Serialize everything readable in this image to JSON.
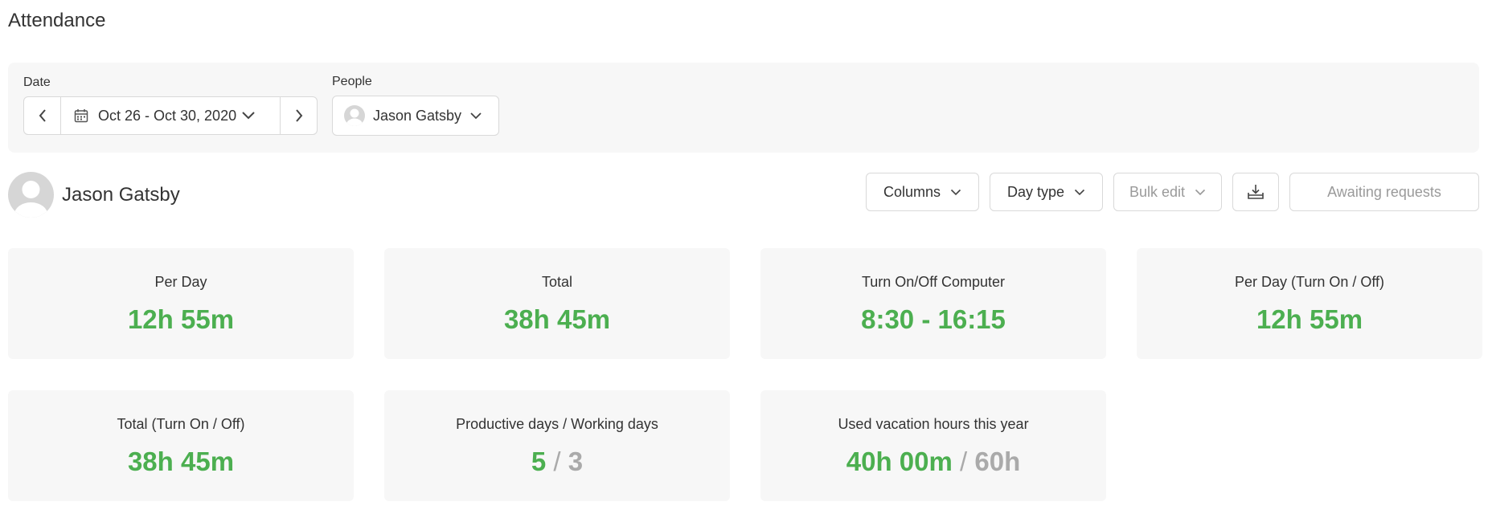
{
  "page": {
    "title": "Attendance"
  },
  "filters": {
    "date_label": "Date",
    "date_range": "Oct 26 - Oct 30, 2020",
    "people_label": "People",
    "people_value": "Jason Gatsby"
  },
  "user": {
    "name": "Jason Gatsby"
  },
  "toolbar": {
    "columns_label": "Columns",
    "day_type_label": "Day type",
    "bulk_edit_label": "Bulk edit",
    "awaiting_label": "Awaiting requests"
  },
  "stats": {
    "per_day": {
      "label": "Per Day",
      "value": "12h 55m"
    },
    "total": {
      "label": "Total",
      "value": "38h 45m"
    },
    "turn_on_off": {
      "label": "Turn On/Off Computer",
      "value": "8:30 - 16:15"
    },
    "per_day_turn": {
      "label": "Per Day (Turn On / Off)",
      "value": "12h 55m"
    },
    "total_turn": {
      "label": "Total (Turn On / Off)",
      "value": "38h 45m"
    },
    "productive": {
      "label": "Productive days / Working days",
      "value": "5",
      "separator": "/",
      "secondary": "3"
    },
    "vacation": {
      "label": "Used vacation hours this year",
      "value": "40h 00m",
      "separator": "/",
      "secondary": "60h"
    }
  },
  "colors": {
    "accent_green": "#4caf50",
    "muted_gray": "#aaaaaa",
    "panel_bg": "#f7f7f7",
    "border": "#d9d9d9"
  },
  "icons": [
    "chevron-left-icon",
    "calendar-icon",
    "chevron-down-icon",
    "chevron-right-icon",
    "avatar-icon",
    "download-icon"
  ]
}
